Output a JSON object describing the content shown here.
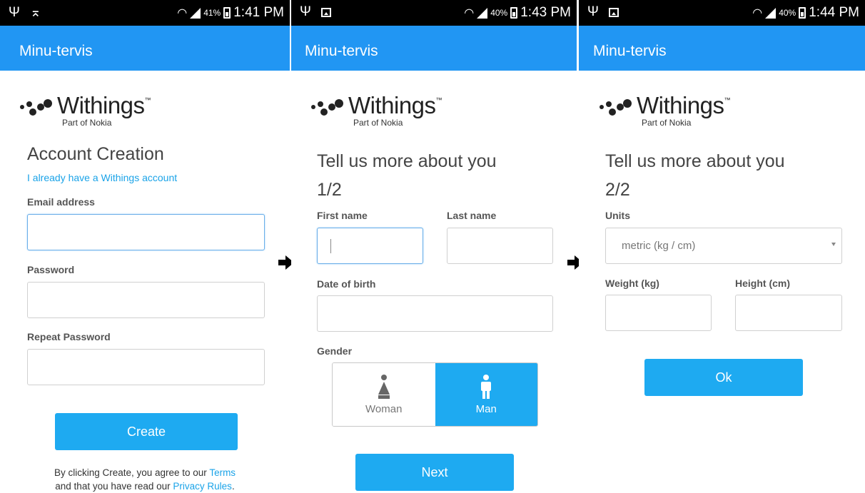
{
  "colors": {
    "appbar": "#2196f3",
    "button": "#1eaaf1",
    "link": "#1aa3e8",
    "focus_border": "#6aaee8"
  },
  "brand": {
    "name": "Withings",
    "trademark": "™",
    "tagline": "Part of Nokia"
  },
  "screens": [
    {
      "status": {
        "battery_pct": "41%",
        "time": "1:41 PM",
        "icons": [
          "usb-icon",
          "notification-icon",
          "wifi-icon",
          "signal-icon",
          "battery-icon"
        ]
      },
      "app_title": "Minu-tervis",
      "title": "Account Creation",
      "login_link": "I already have a Withings account",
      "fields": {
        "email_label": "Email address",
        "email_value": "",
        "password_label": "Password",
        "password_value": "",
        "repeat_label": "Repeat Password",
        "repeat_value": ""
      },
      "button": "Create",
      "footer": {
        "pre": "By clicking Create, you agree to our ",
        "terms": "Terms",
        "mid": "and that you have read our ",
        "privacy": "Privacy Rules",
        "end": "."
      }
    },
    {
      "status": {
        "battery_pct": "40%",
        "time": "1:43 PM",
        "icons": [
          "usb-icon",
          "image-icon",
          "wifi-icon",
          "signal-icon",
          "battery-icon"
        ]
      },
      "app_title": "Minu-tervis",
      "title": "Tell us more about you",
      "step": "1/2",
      "fields": {
        "first_label": "First name",
        "first_value": "",
        "last_label": "Last name",
        "last_value": "",
        "dob_label": "Date of birth",
        "dob_value": "",
        "gender_label": "Gender"
      },
      "gender": {
        "woman": "Woman",
        "man": "Man",
        "selected": "Man"
      },
      "button": "Next"
    },
    {
      "status": {
        "battery_pct": "40%",
        "time": "1:44 PM",
        "icons": [
          "usb-icon",
          "image-icon",
          "wifi-icon",
          "signal-icon",
          "battery-icon"
        ]
      },
      "app_title": "Minu-tervis",
      "title": "Tell us more about you",
      "step": "2/2",
      "fields": {
        "units_label": "Units",
        "units_value": "metric (kg / cm)",
        "weight_label": "Weight (kg)",
        "weight_value": "",
        "height_label": "Height (cm)",
        "height_value": ""
      },
      "button": "Ok"
    }
  ]
}
